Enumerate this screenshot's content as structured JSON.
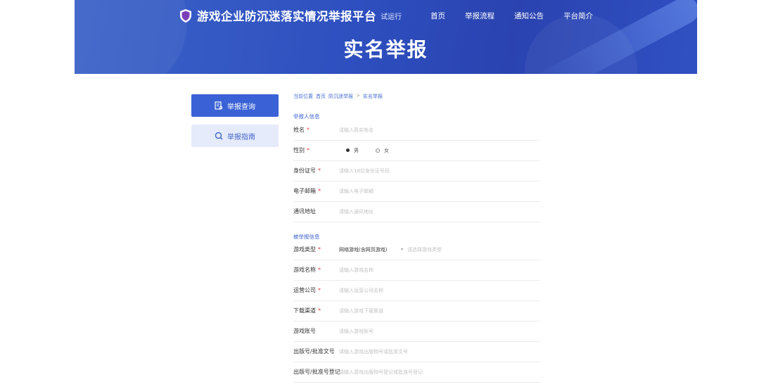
{
  "header": {
    "platform_title": "游戏企业防沉迷落实情况举报平台",
    "platform_sub": "试运行",
    "nav": [
      "首页",
      "举报流程",
      "通知公告",
      "平台简介"
    ],
    "page_title": "实名举报"
  },
  "sidebar": {
    "query_label": "举报查询",
    "guide_label": "举报指南"
  },
  "breadcrumb": [
    "当前位置",
    "首页",
    "防沉迷举报",
    "实名举报"
  ],
  "form": {
    "section_personal": "举报人信息",
    "section_game": "被举报信息",
    "fields": {
      "name": {
        "label": "姓名",
        "required": true,
        "placeholder": "请输入真实姓名"
      },
      "gender": {
        "label": "性别",
        "required": true,
        "options": [
          "男",
          "女"
        ]
      },
      "id_no": {
        "label": "身份证号",
        "required": true,
        "placeholder": "请输入18位身份证号码"
      },
      "email": {
        "label": "电子邮箱",
        "required": true,
        "placeholder": "请输入电子邮箱"
      },
      "contact": {
        "label": "通讯地址",
        "required": false,
        "placeholder": "请输入通讯地址"
      },
      "game_type": {
        "label": "游戏类型",
        "required": true,
        "value": "网络游戏(含网页游戏)",
        "hint": "请选择游戏类型"
      },
      "game_name": {
        "label": "游戏名称",
        "required": true,
        "placeholder": "请输入游戏名称"
      },
      "company": {
        "label": "运营公司",
        "required": true,
        "placeholder": "请输入运营公司名称"
      },
      "download": {
        "label": "下载渠道",
        "required": true,
        "placeholder": "请输入游戏下载渠道"
      },
      "account": {
        "label": "游戏账号",
        "required": false,
        "placeholder": "请输入游戏账号"
      },
      "isbn": {
        "label": "出版号/批准文号",
        "required": false,
        "placeholder": "请输入游戏出版物号或批准文号"
      },
      "record": {
        "label": "出版号/批准号登记",
        "required": false,
        "placeholder": "请输入游戏出版物号登记或批准号登记"
      }
    }
  },
  "colors": {
    "primary": "#3a62d6",
    "accent_light": "#e5ebfb",
    "required": "#e23b3b"
  }
}
